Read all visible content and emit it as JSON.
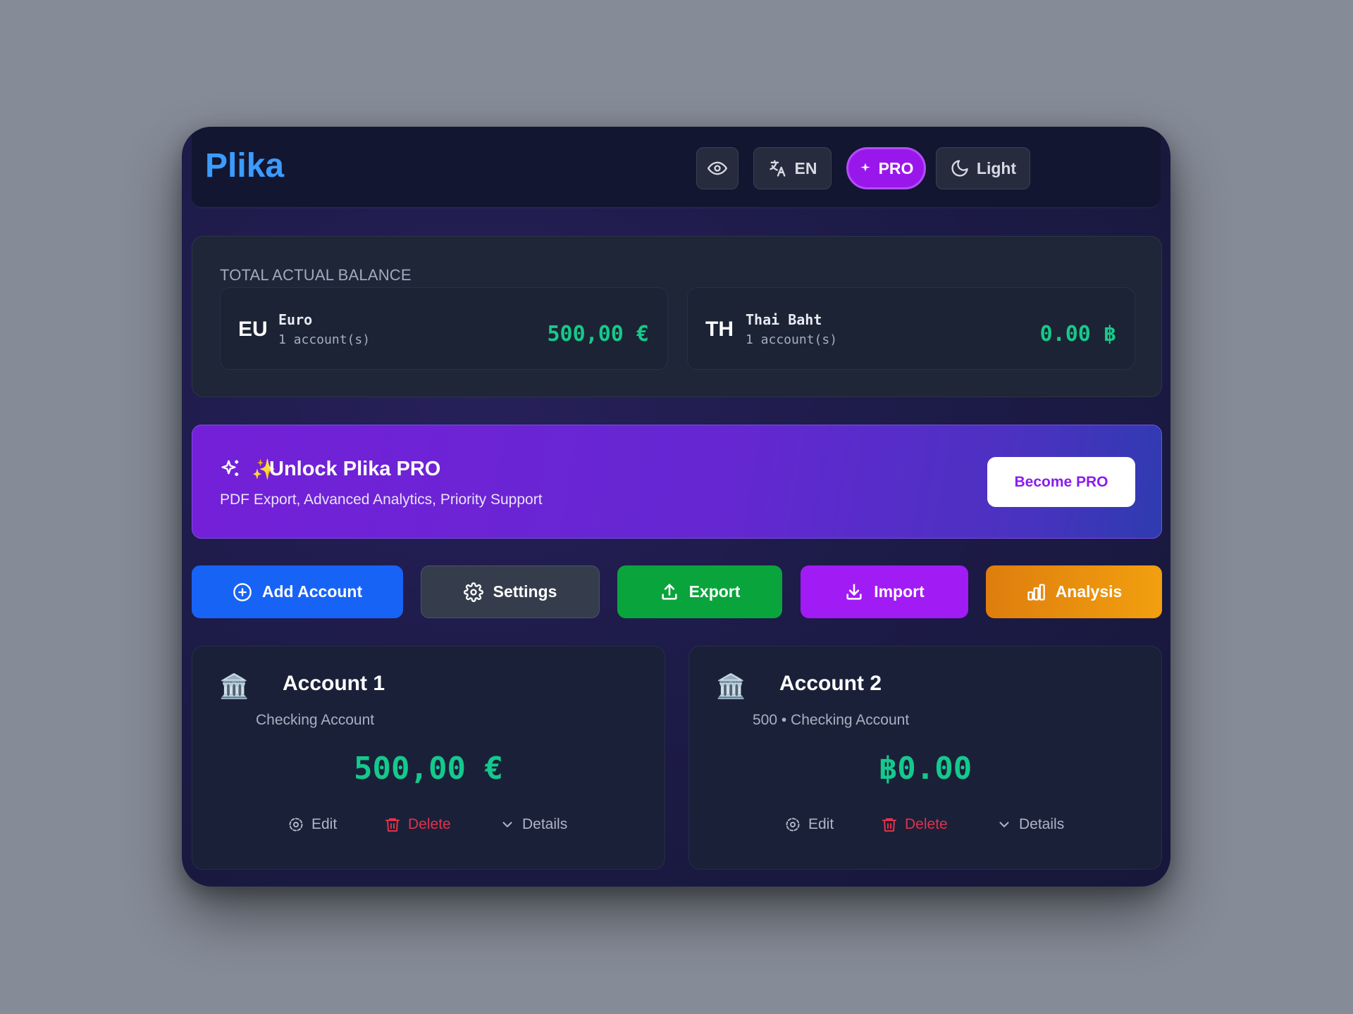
{
  "app": {
    "brand": "Plika"
  },
  "topbar": {
    "visibility_icon": "eye-icon",
    "language": {
      "icon": "translate-icon",
      "label": "EN"
    },
    "pro": {
      "icon": "sparkle-icon",
      "label": "PRO",
      "color": "#9a17ec"
    },
    "theme": {
      "icon": "moon-icon",
      "label": "Light"
    }
  },
  "balance": {
    "title": "TOTAL ACTUAL BALANCE",
    "currencies": [
      {
        "code": "EU",
        "name": "Euro",
        "count": "1 account(s)",
        "amount": "500,00 €"
      },
      {
        "code": "TH",
        "name": "Thai Baht",
        "count": "1 account(s)",
        "amount": "0.00 ฿"
      }
    ],
    "amount_color": "#17c98a"
  },
  "promo": {
    "emoji": "✨",
    "title": "Unlock Plika PRO",
    "subtitle": "PDF Export, Advanced Analytics, Priority Support",
    "button": "Become PRO"
  },
  "actions": [
    {
      "label": "Add Account",
      "icon": "plus-circle-icon",
      "color": "#1763f5"
    },
    {
      "label": "Settings",
      "icon": "gear-icon",
      "color": "#353d4d"
    },
    {
      "label": "Export",
      "icon": "upload-icon",
      "color": "#0aa43d"
    },
    {
      "label": "Import",
      "icon": "download-icon",
      "color": "#a11bf5"
    },
    {
      "label": "Analysis",
      "icon": "bar-chart-icon",
      "color": "#e58a0c"
    }
  ],
  "accounts": [
    {
      "icon": "bank-icon",
      "title": "Account 1",
      "subtitle": "Checking Account",
      "balance": "500,00 €",
      "edit": "Edit",
      "delete": "Delete",
      "details": "Details"
    },
    {
      "icon": "bank-icon",
      "title": "Account 2",
      "subtitle": "500 • Checking Account",
      "balance": "฿0.00",
      "edit": "Edit",
      "delete": "Delete",
      "details": "Details"
    }
  ]
}
